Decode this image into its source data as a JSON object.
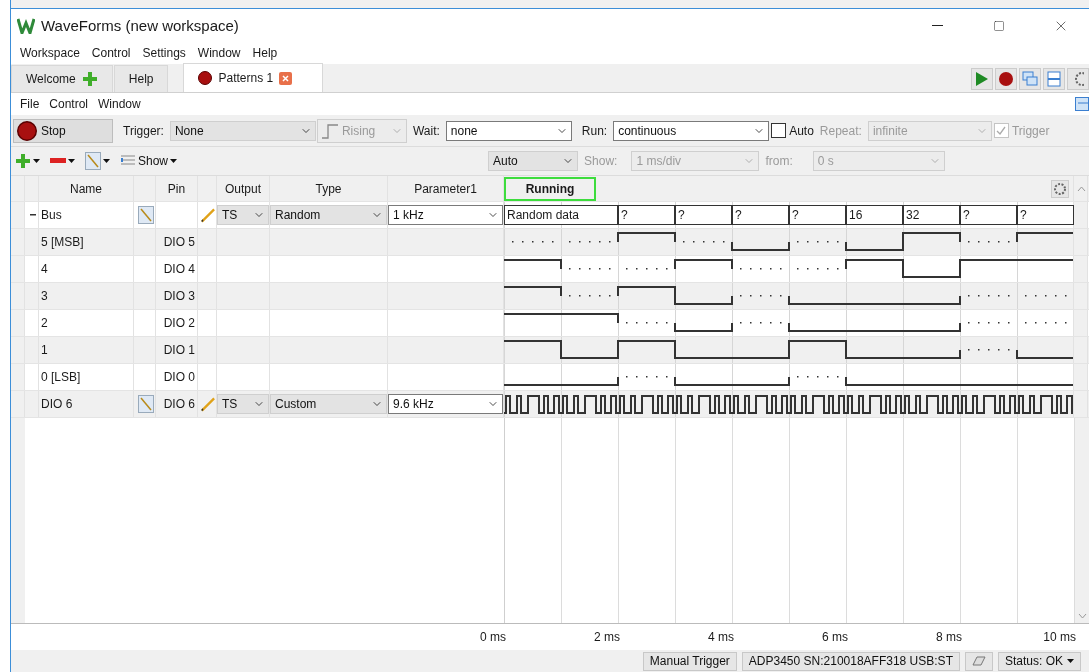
{
  "window": {
    "title": "WaveForms (new workspace)"
  },
  "menu": [
    "Workspace",
    "Control",
    "Settings",
    "Window",
    "Help"
  ],
  "tabs": [
    {
      "label": "Welcome",
      "kind": "add",
      "selected": false
    },
    {
      "label": "Help",
      "kind": "plain",
      "selected": false
    },
    {
      "label": "Patterns 1",
      "kind": "closable",
      "selected": true
    }
  ],
  "submenu": [
    "File",
    "Control",
    "Window"
  ],
  "control_bar": {
    "stop": "Stop",
    "trigger_label": "Trigger:",
    "trigger": "None",
    "edge": {
      "value": "Rising",
      "disabled": true
    },
    "wait_label": "Wait:",
    "wait": "none",
    "run_label": "Run:",
    "run": "continuous",
    "auto": {
      "label": "Auto",
      "checked": false
    },
    "repeat_label": "Repeat:",
    "repeat": {
      "value": "infinite",
      "disabled": true
    },
    "trigger_check": {
      "label": "Trigger",
      "checked": true,
      "disabled": true
    }
  },
  "view_bar": {
    "show_button": "Show",
    "mode": "Auto",
    "show_label": "Show:",
    "scale": "1 ms/div",
    "from_label": "from:",
    "from": "0 s",
    "disabled": true
  },
  "table": {
    "columns": [
      "Name",
      "Pin",
      "Output",
      "Type",
      "Parameter1"
    ],
    "status": "Running",
    "rows": [
      {
        "kind": "bus",
        "name": "Bus",
        "expanded": true,
        "output": "TS",
        "type": "Random",
        "parameter": "1 kHz",
        "values": [
          "Random data",
          "?",
          "?",
          "?",
          "?",
          "16",
          "32",
          "?",
          "?"
        ]
      },
      {
        "kind": "bit",
        "name": "5 [MSB]",
        "pin": "DIO 5"
      },
      {
        "kind": "bit",
        "name": "4",
        "pin": "DIO 4"
      },
      {
        "kind": "bit",
        "name": "3",
        "pin": "DIO 3"
      },
      {
        "kind": "bit",
        "name": "2",
        "pin": "DIO 2"
      },
      {
        "kind": "bit",
        "name": "1",
        "pin": "DIO 1"
      },
      {
        "kind": "bit",
        "name": "0 [LSB]",
        "pin": "DIO 0"
      },
      {
        "kind": "signal",
        "name": "DIO 6",
        "pin": "DIO 6",
        "output": "TS",
        "type": "Custom",
        "parameter": "9.6 kHz"
      }
    ]
  },
  "time_axis": [
    "0 ms",
    "2 ms",
    "4 ms",
    "6 ms",
    "8 ms",
    "10 ms"
  ],
  "status_bar": [
    "Manual Trigger",
    "ADP3450 SN:210018AFF318 USB:ST",
    "Status: OK"
  ]
}
